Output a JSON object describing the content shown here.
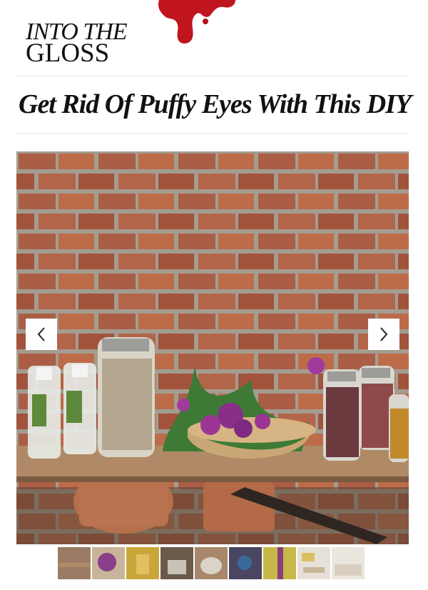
{
  "header": {
    "logo_line1": "INTO THE",
    "logo_line2": "GLOSS"
  },
  "article": {
    "title": "Get Rid Of Puffy Eyes With This DIY"
  },
  "gallery": {
    "prev_icon": "chevron-left-icon",
    "next_icon": "chevron-right-icon",
    "thumbnail_count": 9,
    "thumbnail_colors": [
      "#9b7b65",
      "#8a3f8a",
      "#c9a63a",
      "#6b5a4a",
      "#a8876a",
      "#4a4560",
      "#c8b84a",
      "#d9d1c3",
      "#e8e2d8"
    ]
  },
  "colors": {
    "brand_red": "#c0141e",
    "brick": "#a5573f",
    "mortar": "#a9ada4"
  }
}
